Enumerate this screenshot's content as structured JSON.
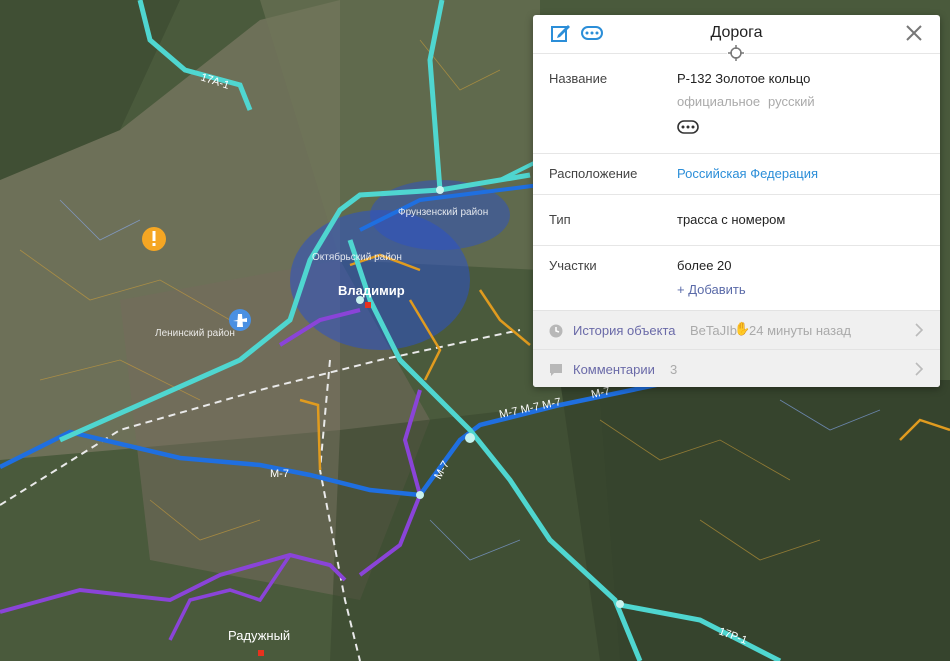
{
  "map": {
    "road_labels": {
      "r17a1": "17А-1",
      "m7_east": "М-7 М-7 М-7",
      "m7_east_tail": "М-7",
      "m7_west": "М-7",
      "m7_diag": "М-7",
      "r17r1": "17Р-1"
    },
    "place_labels": {
      "city": "Владимир",
      "frunzensky": "Фрунзенский район",
      "oktyabrsky": "Октябрьский район",
      "leninsky": "Ленинский район",
      "raduzhny": "Радужный"
    },
    "colors": {
      "trunk": "#4fd6d0",
      "federal": "#1f6fe0",
      "regional": "#e09b1f",
      "local": "#8a44d8"
    },
    "icons": [
      "warning-icon",
      "airport-icon"
    ]
  },
  "card": {
    "title": "Дорога",
    "rows": [
      {
        "label": "Название",
        "value": "Р-132 Золотое кольцо",
        "meta1": "официальное",
        "meta2": "русский"
      },
      {
        "label": "Расположение",
        "value": "Российская Федерация"
      },
      {
        "label": "Тип",
        "value": "трасса с номером"
      },
      {
        "label": "Участки",
        "value": "более 20",
        "action": "+ Добавить"
      }
    ],
    "history": {
      "label": "История объекта",
      "user": "BeTaJIb",
      "time": "24 минуты назад"
    },
    "comments": {
      "label": "Комментарии",
      "count": "3"
    }
  }
}
